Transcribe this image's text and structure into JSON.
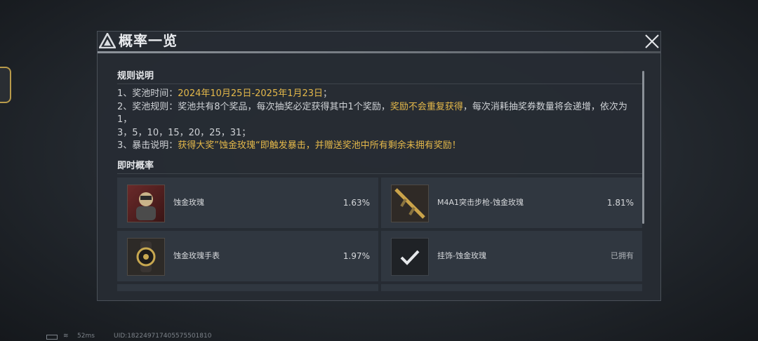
{
  "dialog": {
    "title": "概率一览",
    "close_icon": "close-icon"
  },
  "rules_section": {
    "title": "规则说明",
    "lines": [
      {
        "prefix": "1、奖池时间：",
        "highlight": "2024年10月25日-2025年1月23日",
        "suffix": "；"
      },
      {
        "prefix": "2、奖池规则：奖池共有8个奖品，每次抽奖必定获得其中1个奖励，",
        "highlight": "奖励不会重复获得",
        "suffix": "，每次消耗抽奖券数量将会递增，依次为1，"
      },
      {
        "prefix": "3，5，10，15，20，25，31；",
        "highlight": "",
        "suffix": ""
      },
      {
        "prefix": "3、暴击说明：",
        "highlight": "获得大奖”蚀金玫瑰“即触发暴击，并赠送奖池中所有剩余未拥有奖励！",
        "suffix": ""
      }
    ]
  },
  "probability_section": {
    "title": "即时概率",
    "items": [
      {
        "name": "蚀金玫瑰",
        "value": "1.63%",
        "icon": "operator-portrait-icon"
      },
      {
        "name": "M4A1突击步枪-蚀金玫瑰",
        "value": "1.81%",
        "icon": "rifle-icon"
      },
      {
        "name": "蚀金玫瑰手表",
        "value": "1.97%",
        "icon": "watch-icon"
      },
      {
        "name": "挂饰-蚀金玫瑰",
        "value": "已拥有",
        "icon": "checkmark-icon"
      }
    ]
  },
  "status_bar": {
    "ping": "52ms",
    "uid": "UID:182249717405575501810"
  },
  "colors": {
    "highlight": "#e4b84a",
    "panel": "#262c33",
    "card": "#303740"
  }
}
